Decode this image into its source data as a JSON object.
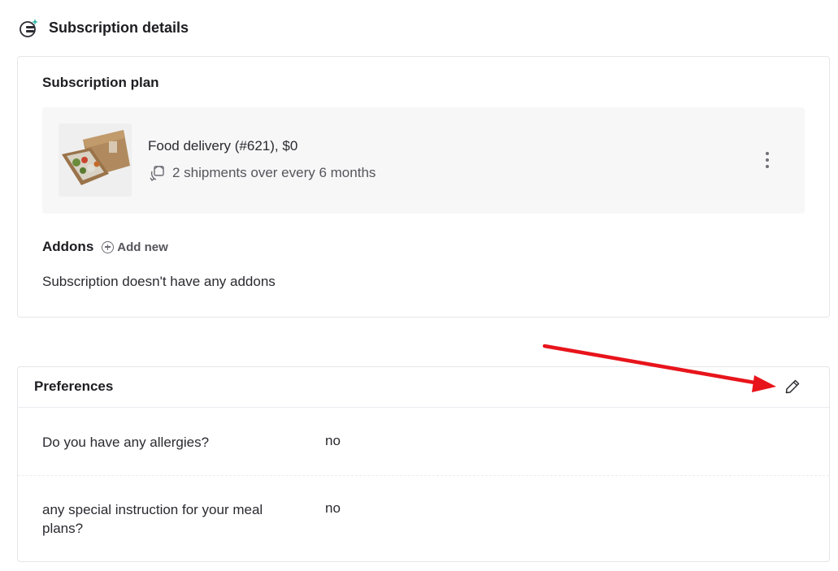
{
  "header": {
    "title": "Subscription details",
    "icon": "subscription-refresh-icon"
  },
  "plan": {
    "heading": "Subscription plan",
    "product": {
      "name": "Food delivery (#621), $0",
      "shipments": "2 shipments over every 6 months",
      "thumbnail": "meal-box-image",
      "menu_icon": "more-vertical-icon"
    },
    "addons": {
      "title": "Addons",
      "add_label": "Add new",
      "empty_text": "Subscription doesn't have any addons"
    }
  },
  "preferences": {
    "title": "Preferences",
    "edit_icon": "pencil-icon",
    "rows": [
      {
        "question": "Do you have any allergies?",
        "answer": "no"
      },
      {
        "question": "any special instruction for your meal plans?",
        "answer": "no"
      }
    ]
  },
  "colors": {
    "annotation_arrow": "#e8141b",
    "accent_sparkle": "#2bb7a8",
    "card_border": "#e6e6ea",
    "plan_box_bg": "#f7f7f8"
  }
}
